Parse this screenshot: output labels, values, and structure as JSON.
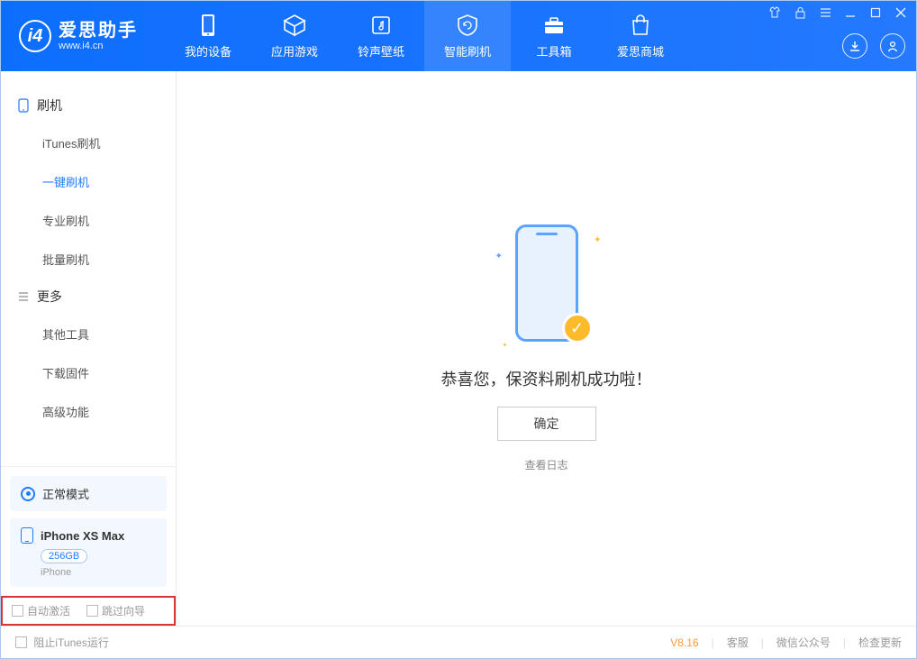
{
  "app": {
    "title": "爱思助手",
    "url": "www.i4.cn"
  },
  "header_tabs": [
    {
      "label": "我的设备"
    },
    {
      "label": "应用游戏"
    },
    {
      "label": "铃声壁纸"
    },
    {
      "label": "智能刷机"
    },
    {
      "label": "工具箱"
    },
    {
      "label": "爱思商城"
    }
  ],
  "sidebar": {
    "group1_title": "刷机",
    "group1_items": [
      {
        "label": "iTunes刷机"
      },
      {
        "label": "一键刷机"
      },
      {
        "label": "专业刷机"
      },
      {
        "label": "批量刷机"
      }
    ],
    "group2_title": "更多",
    "group2_items": [
      {
        "label": "其他工具"
      },
      {
        "label": "下载固件"
      },
      {
        "label": "高级功能"
      }
    ],
    "status_text": "正常模式",
    "device_name": "iPhone XS Max",
    "storage": "256GB",
    "device_type": "iPhone",
    "cb_auto_activate": "自动激活",
    "cb_skip_guide": "跳过向导"
  },
  "main": {
    "success_message": "恭喜您，保资料刷机成功啦！",
    "ok_button": "确定",
    "view_log": "查看日志"
  },
  "footer": {
    "block_itunes": "阻止iTunes运行",
    "version": "V8.16",
    "customer_service": "客服",
    "wechat": "微信公众号",
    "check_update": "检查更新"
  }
}
